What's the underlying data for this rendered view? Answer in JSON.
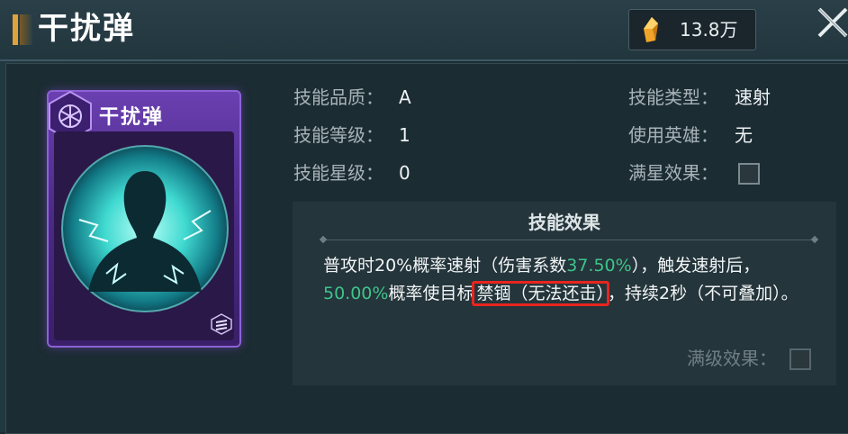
{
  "header": {
    "title": "干扰弹",
    "currency_amount": "13.8万",
    "close_icon": "close-x-icon",
    "currency_icon": "crystal-icon"
  },
  "card": {
    "title": "干扰弹",
    "emblem_icon": "hexagon-emblem-icon",
    "art_icon": "silhouette-lightning-art",
    "badge_icon": "stripe-badge-icon"
  },
  "skill_info": {
    "quality_label": "技能品质：",
    "quality_value": "A",
    "level_label": "技能等级：",
    "level_value": "1",
    "star_label": "技能星级：",
    "star_value": "0",
    "type_label": "技能类型：",
    "type_value": "速射",
    "hero_label": "使用英雄：",
    "hero_value": "无",
    "fullstar_label": "满星效果："
  },
  "effect": {
    "title": "技能效果",
    "text_1": "普攻时20%概率速射（伤害系数",
    "coef": "37.50%",
    "text_2": "），触发速射后，",
    "prob": "50.00%",
    "text_3": "概率使目标",
    "highlight": "禁锢（无法还击）",
    "text_4": "，持续2秒（不可叠加）。",
    "maxlevel_label": "满级效果："
  },
  "colors": {
    "accent_green": "#3fc48a",
    "highlight_red": "#e8251f",
    "card_purple": "#6a3fb0"
  }
}
